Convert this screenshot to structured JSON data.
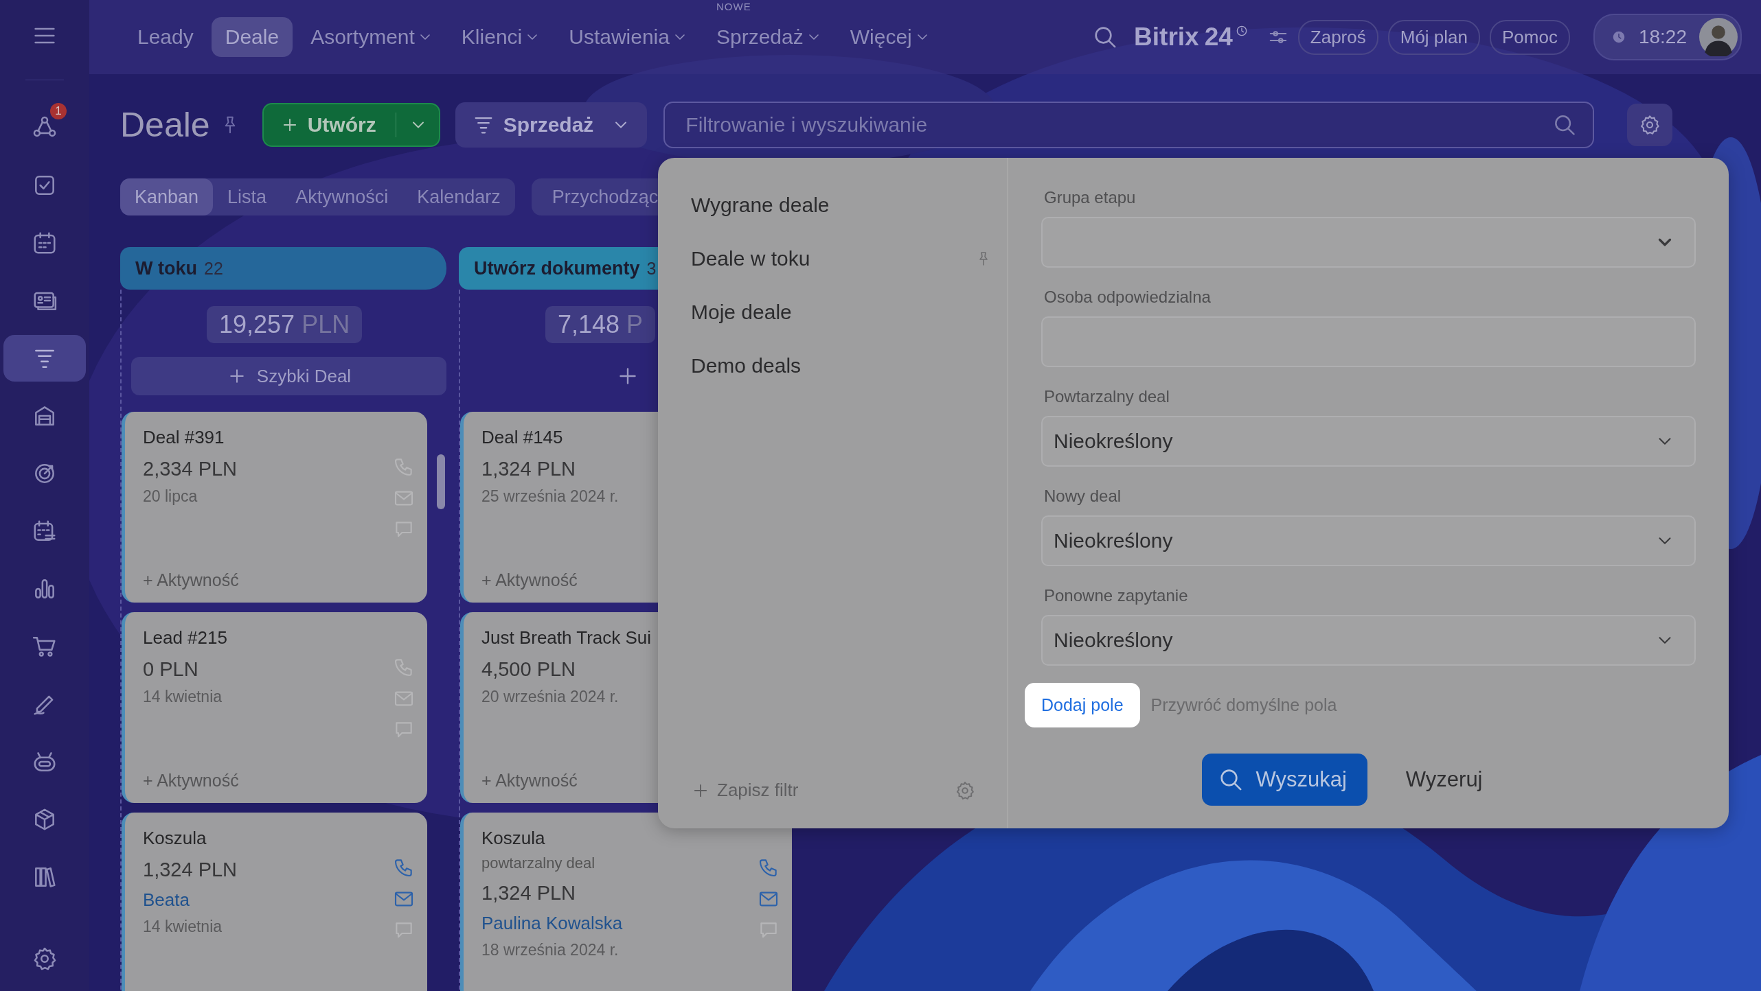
{
  "topbar": {
    "nav": [
      {
        "label": "Leady",
        "selected": false,
        "dropdown": false
      },
      {
        "label": "Deale",
        "selected": true,
        "dropdown": false
      },
      {
        "label": "Asortyment",
        "selected": false,
        "dropdown": true
      },
      {
        "label": "Klienci",
        "selected": false,
        "dropdown": true
      },
      {
        "label": "Ustawienia",
        "selected": false,
        "dropdown": true
      },
      {
        "label": "Sprzedaż",
        "selected": false,
        "dropdown": true,
        "tag": "NOWE"
      },
      {
        "label": "Więcej",
        "selected": false,
        "dropdown": true
      }
    ],
    "brand": "Bitrix",
    "brand_number": "24",
    "buttons": [
      "Zaproś",
      "Mój plan",
      "Pomoc"
    ],
    "time": "18:22"
  },
  "sidebar": {
    "items": [
      {
        "selected": false,
        "badge": "1"
      },
      {
        "selected": false
      },
      {
        "selected": false
      },
      {
        "selected": false
      },
      {
        "selected": true
      },
      {
        "selected": false
      },
      {
        "selected": false
      },
      {
        "selected": false
      },
      {
        "selected": false
      },
      {
        "selected": false
      },
      {
        "selected": false
      },
      {
        "selected": false
      },
      {
        "selected": false
      },
      {
        "selected": false
      }
    ]
  },
  "page": {
    "title": "Deale",
    "create_button": "Utwórz",
    "pipeline_button": "Sprzedaż",
    "search": {
      "placeholder": "Filtrowanie i wyszukiwanie"
    }
  },
  "views": [
    {
      "label": "Kanban",
      "selected": true
    },
    {
      "label": "Lista",
      "selected": false
    },
    {
      "label": "Aktywności",
      "selected": false
    },
    {
      "label": "Kalendarz",
      "selected": false
    }
  ],
  "extra_view": "Przychodząc",
  "columns": [
    {
      "title": "W toku",
      "count": "22",
      "color": "#25679a",
      "total": "19,257",
      "currency": "PLN",
      "add_label": "Szybki Deal",
      "scrollbar": true,
      "cards": [
        {
          "title": "Deal #391",
          "amount": "2,334 PLN",
          "date": "20 lipca",
          "activity": "+ Aktywność",
          "contacts_active": false
        },
        {
          "title": "Lead #215",
          "amount": "0 PLN",
          "date": "14 kwietnia",
          "activity": "+ Aktywność",
          "contacts_active": false
        },
        {
          "title": "Koszula",
          "amount": "1,324 PLN",
          "client": "Beata",
          "date": "14 kwietnia",
          "contacts_active": true
        }
      ]
    },
    {
      "title": "Utwórz dokumenty",
      "count": "3",
      "color": "#2a86aa",
      "total": "7,148",
      "currency": "P",
      "cards": [
        {
          "title": "Deal #145",
          "amount": "1,324 PLN",
          "date": "25 września 2024 r.",
          "activity": "+ Aktywność"
        },
        {
          "title": "Just Breath Track Sui",
          "amount": "4,500 PLN",
          "date": "20 września 2024 r.",
          "activity": "+ Aktywność"
        },
        {
          "title": "Koszula",
          "subtitle": "powtarzalny deal",
          "amount": "1,324 PLN",
          "client": "Paulina Kowalska",
          "date": "18 września 2024 r.",
          "contacts_active": true
        }
      ]
    }
  ],
  "filter_popup": {
    "presets": [
      {
        "label": "Wygrane deale",
        "pinned": false
      },
      {
        "label": "Deale w toku",
        "pinned": true
      },
      {
        "label": "Moje deale",
        "pinned": false
      },
      {
        "label": "Demo deals",
        "pinned": false
      }
    ],
    "save_filter": "Zapisz filtr",
    "fields": [
      {
        "label": "Grupa etapu",
        "kind": "select"
      },
      {
        "label": "Osoba odpowiedzialna",
        "kind": "input"
      },
      {
        "label": "Powtarzalny deal",
        "kind": "select",
        "value": "Nieokreślony"
      },
      {
        "label": "Nowy deal",
        "kind": "select",
        "value": "Nieokreślony"
      },
      {
        "label": "Ponowne zapytanie",
        "kind": "select",
        "value": "Nieokreślony"
      }
    ],
    "add_field": {
      "label": "Dodaj pole",
      "highlighted": true
    },
    "restore_fields": "Przywróć domyślne pola",
    "search_button": "Wyszukaj",
    "reset_button": "Wyzeruj"
  }
}
